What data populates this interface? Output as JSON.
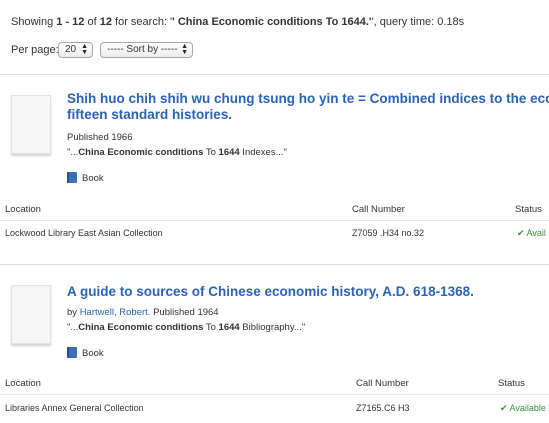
{
  "search_summary": {
    "prefix": "Showing",
    "range": "1 - 12",
    "of_word": "of",
    "total": "12",
    "for_search": "for search: '",
    "query": "' China Economic conditions To 1644.'",
    "query_time": "', query time: 0.18s"
  },
  "controls": {
    "per_page_label": "Per page:",
    "per_page_value": "20",
    "sort_value": "----- Sort by -----"
  },
  "records": [
    {
      "title_line1": "Shih huo chih shih wu chung tsung ho yin te = Combined indices to the econor",
      "title_line2": "fifteen standard histories.",
      "published": "Published 1966",
      "snippet_prefix": "\"...",
      "snippet_bold": "China Economic conditions",
      "snippet_mid": " To ",
      "snippet_bold2": "1644",
      "snippet_suffix": " Indexes...\"",
      "format": "Book",
      "holdings_headers": {
        "location": "Location",
        "call_number": "Call Number",
        "status": "Status"
      },
      "holding": {
        "location": "Lockwood Library East Asian Collection",
        "call_number": "Z7059 .H34 no.32",
        "status": "✔ Avail"
      }
    },
    {
      "title_line1": "A guide to sources of Chinese economic history, A.D. 618-1368.",
      "by": "by",
      "author": "Hartwell, Robert.",
      "published": "Published 1964",
      "snippet_prefix": "\"...",
      "snippet_bold": "China Economic conditions",
      "snippet_mid": " To ",
      "snippet_bold2": "1644",
      "snippet_suffix": " Bibliography...\"",
      "format": "Book",
      "holdings_headers": {
        "location": "Location",
        "call_number": "Call Number",
        "status": "Status"
      },
      "holding": {
        "location": "Libraries Annex General Collection",
        "call_number": "Z7165.C6 H3",
        "status": "✔ Available"
      }
    }
  ]
}
